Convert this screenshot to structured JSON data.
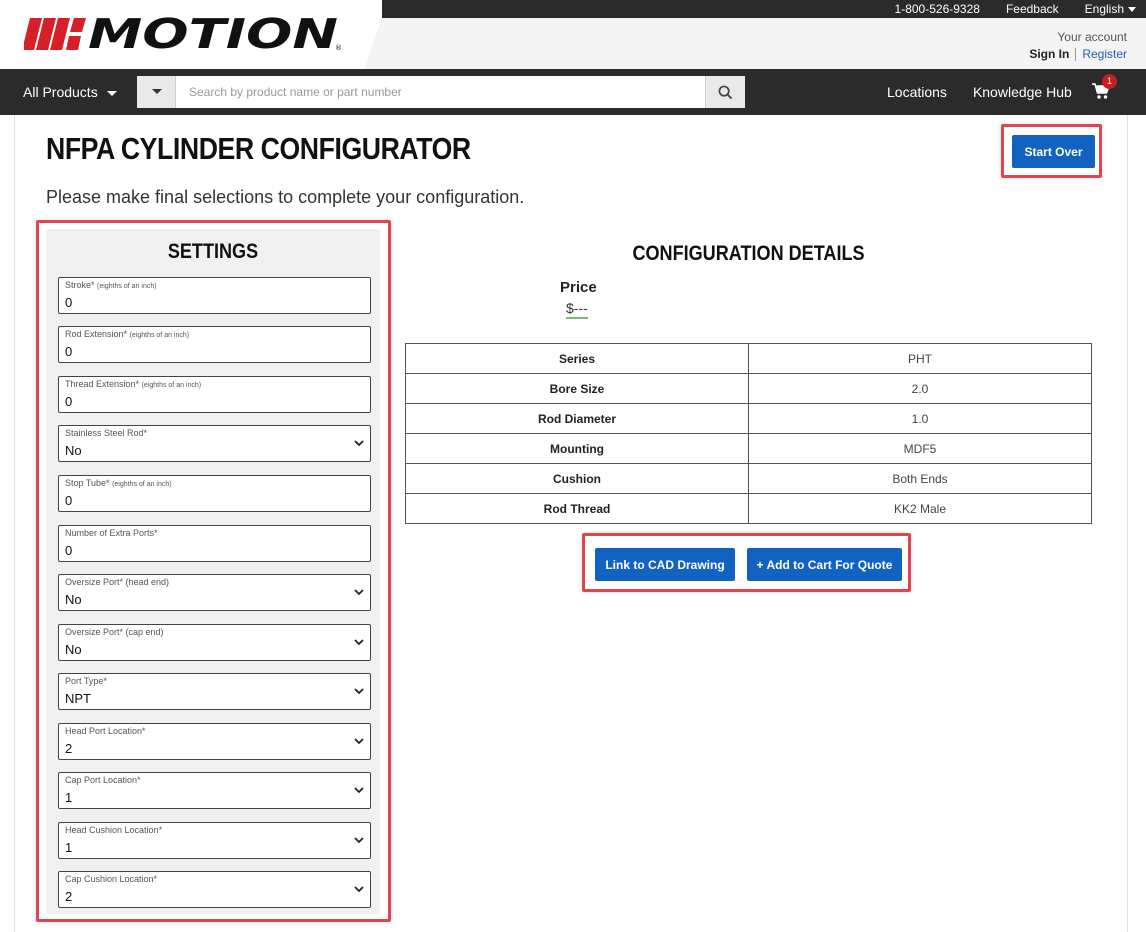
{
  "header": {
    "logo_text": "MiMOTION",
    "phone": "1-800-526-9328",
    "feedback": "Feedback",
    "language": "English",
    "account_label": "Your account",
    "sign_in": "Sign In",
    "register": "Register"
  },
  "nav": {
    "all_products": "All Products",
    "search_placeholder": "Search by product name or part number",
    "search_value": "",
    "locations": "Locations",
    "knowledge_hub": "Knowledge Hub",
    "cart_count": "1"
  },
  "page": {
    "title": "NFPA CYLINDER CONFIGURATOR",
    "subtitle": "Please make final selections to complete your configuration.",
    "start_over": "Start Over"
  },
  "settings": {
    "title": "SETTINGS",
    "fields": [
      {
        "label": "Stroke*",
        "hint": "(eighths of an inch)",
        "value": "0",
        "type": "input"
      },
      {
        "label": "Rod Extension*",
        "hint": "(eighths of an inch)",
        "value": "0",
        "type": "input"
      },
      {
        "label": "Thread Extension*",
        "hint": "(eighths of an inch)",
        "value": "0",
        "type": "input"
      },
      {
        "label": "Stainless Steel Rod*",
        "hint": "",
        "value": "No",
        "type": "select"
      },
      {
        "label": "Stop Tube*",
        "hint": "(eighths of an inch)",
        "value": "0",
        "type": "input"
      },
      {
        "label": "Number of Extra Ports*",
        "hint": "",
        "value": "0",
        "type": "input"
      },
      {
        "label": "Oversize Port* (head end)",
        "hint": "",
        "value": "No",
        "type": "select"
      },
      {
        "label": "Oversize Port* (cap end)",
        "hint": "",
        "value": "No",
        "type": "select"
      },
      {
        "label": "Port Type*",
        "hint": "",
        "value": "NPT",
        "type": "select"
      },
      {
        "label": "Head Port Location*",
        "hint": "",
        "value": "2",
        "type": "select"
      },
      {
        "label": "Cap Port Location*",
        "hint": "",
        "value": "1",
        "type": "select"
      },
      {
        "label": "Head Cushion Location*",
        "hint": "",
        "value": "1",
        "type": "select"
      },
      {
        "label": "Cap Cushion Location*",
        "hint": "",
        "value": "2",
        "type": "select"
      }
    ]
  },
  "details": {
    "title": "CONFIGURATION DETAILS",
    "price_label": "Price",
    "price_value": "$---",
    "rows": [
      {
        "key": "Series",
        "value": "PHT"
      },
      {
        "key": "Bore Size",
        "value": "2.0"
      },
      {
        "key": "Rod Diameter",
        "value": "1.0"
      },
      {
        "key": "Mounting",
        "value": "MDF5"
      },
      {
        "key": "Cushion",
        "value": "Both Ends"
      },
      {
        "key": "Rod Thread",
        "value": "KK2 Male"
      }
    ],
    "cad_button": "Link to CAD Drawing",
    "cart_button": "+ Add to Cart For Quote"
  },
  "colors": {
    "brand_red": "#d52027",
    "primary_blue": "#1262c2",
    "highlight_red": "#e0464f",
    "dark_bar": "#2b2b2b"
  }
}
